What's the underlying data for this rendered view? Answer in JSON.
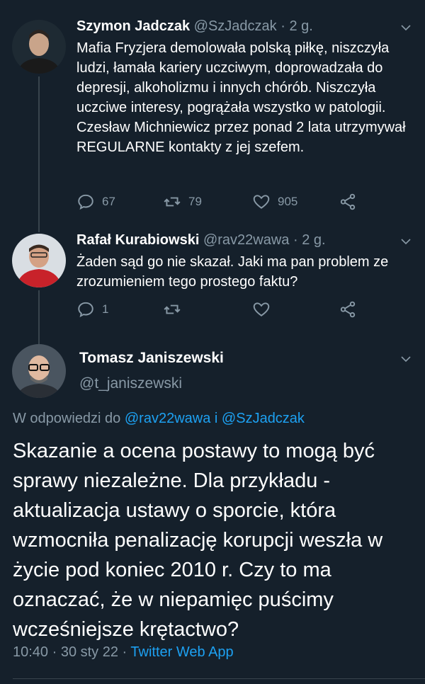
{
  "colors": {
    "background": "#15202b",
    "secondary_text": "#8899a6",
    "link": "#1da1f2",
    "divider": "#38444d"
  },
  "tweets": [
    {
      "name": "Szymon Jadczak",
      "handle": "@SzJadczak",
      "separator": "·",
      "time": "2 g.",
      "text": "Mafia Fryzjera demolowała polską piłkę, niszczyła ludzi, łamała kariery uczciwym, doprowadzała  do depresji, alkoholizmu i innych chórób. Niszczyła uczciwe interesy, pogrążała wszystko w patologii. Czesław Michniewicz przez ponad 2 lata utrzymywał REGULARNE kontakty z jej szefem.",
      "replies": "67",
      "retweets": "79",
      "likes": "905",
      "icons": [
        "reply-icon",
        "retweet-icon",
        "like-icon",
        "share-icon"
      ]
    },
    {
      "name": "Rafał Kurabiowski",
      "handle": "@rav22wawa",
      "separator": "·",
      "time": "2 g.",
      "text": "Żaden sąd go nie skazał. Jaki ma pan problem ze zrozumieniem tego prostego faktu?",
      "replies": "1",
      "retweets": "",
      "likes": "",
      "icons": [
        "reply-icon",
        "retweet-icon",
        "like-icon",
        "share-icon"
      ]
    }
  ],
  "main_tweet": {
    "name": "Tomasz Janiszewski",
    "handle": "@t_janiszewski",
    "reply_prefix": "W odpowiedzi do",
    "reply_user1": "@rav22wawa",
    "reply_and": "i",
    "reply_user2": "@SzJadczak",
    "text": "Skazanie a ocena postawy to mogą być sprawy niezależne. Dla przykładu - aktualizacja ustawy o sporcie, która wzmocniła penalizację korupcji weszła w życie pod koniec 2010 r. Czy to ma oznaczać, że w niepamięc puścimy wcześniejsze krętactwo?",
    "timestamp": "10:40 · 30 sty 22",
    "separator": "·",
    "client": "Twitter Web App"
  }
}
